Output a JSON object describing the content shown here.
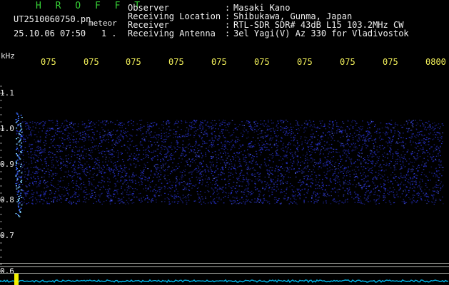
{
  "header": {
    "title": "H R O F F T",
    "filename": "UT2510060750.pn",
    "tag": "meteor",
    "datetime": "25.10.06 07:50",
    "counter": "1 ."
  },
  "info": [
    {
      "label": "Observer",
      "value": "Masaki Kano"
    },
    {
      "label": "Receiving Location",
      "value": "Shibukawa, Gunma, Japan"
    },
    {
      "label": "Receiver",
      "value": "RTL-SDR SDR# 43dB L15 103.2MHz CW"
    },
    {
      "label": "Receiving Antenna",
      "value": "3el Yagi(V) Az 330 for Vladivostok"
    }
  ],
  "info_colon": ":",
  "axes": {
    "unit": "kHz",
    "y_ticks": [
      "1.1",
      "1.0",
      "0.9",
      "0.8",
      "0.7",
      "0.6"
    ],
    "x_ticks": [
      "075",
      "075",
      "075",
      "075",
      "075",
      "075",
      "075",
      "075",
      "075",
      "0800"
    ]
  },
  "colors": {
    "noise": "#2a34d8",
    "signal": "#7fd0ff",
    "text": "#f0f0f0",
    "title": "#37d437",
    "time_ticks": "#f2f05a",
    "baseline": "#00b4e6",
    "marker": "#f2f000"
  }
}
